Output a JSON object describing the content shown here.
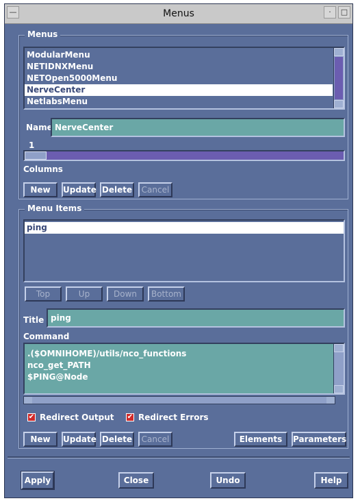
{
  "window": {
    "title": "Menus"
  },
  "menus_group": {
    "title": "Menus",
    "list_items": [
      "ModularMenu",
      "NETIDNXMenu",
      "NETOpen5000Menu",
      "NerveCenter",
      "NetlabsMenu"
    ],
    "selected_index": 3,
    "name_label": "Name",
    "name_value": "NerveCenter",
    "columns_value": "1",
    "columns_label": "Columns",
    "buttons": {
      "new": "New",
      "update": "Update",
      "delete": "Delete",
      "cancel": "Cancel"
    }
  },
  "menu_items_group": {
    "title": "Menu Items",
    "list_items": [
      "ping"
    ],
    "selected_index": 0,
    "move_buttons": {
      "top": "Top",
      "up": "Up",
      "down": "Down",
      "bottom": "Bottom"
    },
    "title_label": "Title",
    "title_value": "ping",
    "command_label": "Command",
    "command_lines": [
      ".($OMNIHOME)/utils/nco_functions",
      "nco_get_PATH",
      "$PING@Node"
    ],
    "redirect_output": {
      "label": "Redirect Output",
      "checked": true
    },
    "redirect_errors": {
      "label": "Redirect Errors",
      "checked": true
    },
    "buttons": {
      "new": "New",
      "update": "Update",
      "delete": "Delete",
      "cancel": "Cancel",
      "elements": "Elements",
      "parameters": "Parameters"
    }
  },
  "footer": {
    "apply": "Apply",
    "close": "Close",
    "undo": "Undo",
    "help": "Help"
  },
  "icons": {
    "checkbox_mark": "✔"
  }
}
